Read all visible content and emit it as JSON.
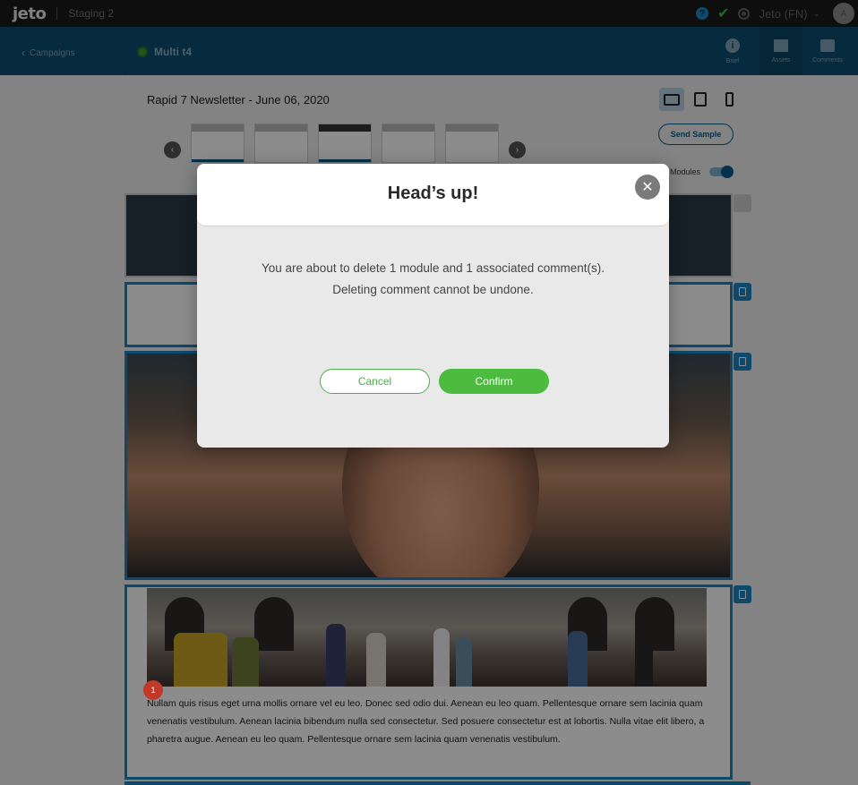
{
  "topbar": {
    "logo": "jeto",
    "environment": "Staging 2",
    "help_icon": "?",
    "check_icon": "✔",
    "user_name": "Jeto (FN)",
    "user_menu_chevron": "⌄",
    "avatar_initial": "A"
  },
  "nav": {
    "back_label": "Campaigns",
    "back_arrow": "‹",
    "campaign_name": "Multi t4",
    "campaign_status_color": "#3f9a3a",
    "buttons": [
      {
        "label": "Brief",
        "icon": "info-icon"
      },
      {
        "label": "Assets",
        "icon": "assets-icon"
      },
      {
        "label": "Comments",
        "icon": "comment-icon"
      }
    ]
  },
  "page": {
    "newsletter_title": "Rapid 7 Newsletter - June 06, 2020",
    "send_sample": "Send Sample",
    "modules_label": "Modules",
    "prev_arrow": "‹",
    "next_arrow": "›",
    "body_text": "Nullam quis risus eget urna mollis ornare vel eu leo. Donec sed odio dui. Aenean eu leo quam. Pellentesque ornare sem lacinia quam venenatis vestibulum. Aenean lacinia bibendum nulla sed consectetur. Sed posuere consectetur est at lobortis. Nulla vitae elit libero, a pharetra augue. Aenean eu leo quam. Pellentesque ornare sem lacinia quam venenatis vestibulum.",
    "comment_badge": "1"
  },
  "modal": {
    "title": "Head’s up!",
    "line1": "You are about to delete 1  module and 1 associated comment(s).",
    "line2": "Deleting comment cannot be undone.",
    "cancel": "Cancel",
    "confirm": "Confirm",
    "close": "✕"
  },
  "colors": {
    "nav_bg": "#0b4f72",
    "accent_green": "#4cbb3f",
    "module_border": "#1a83c4"
  }
}
